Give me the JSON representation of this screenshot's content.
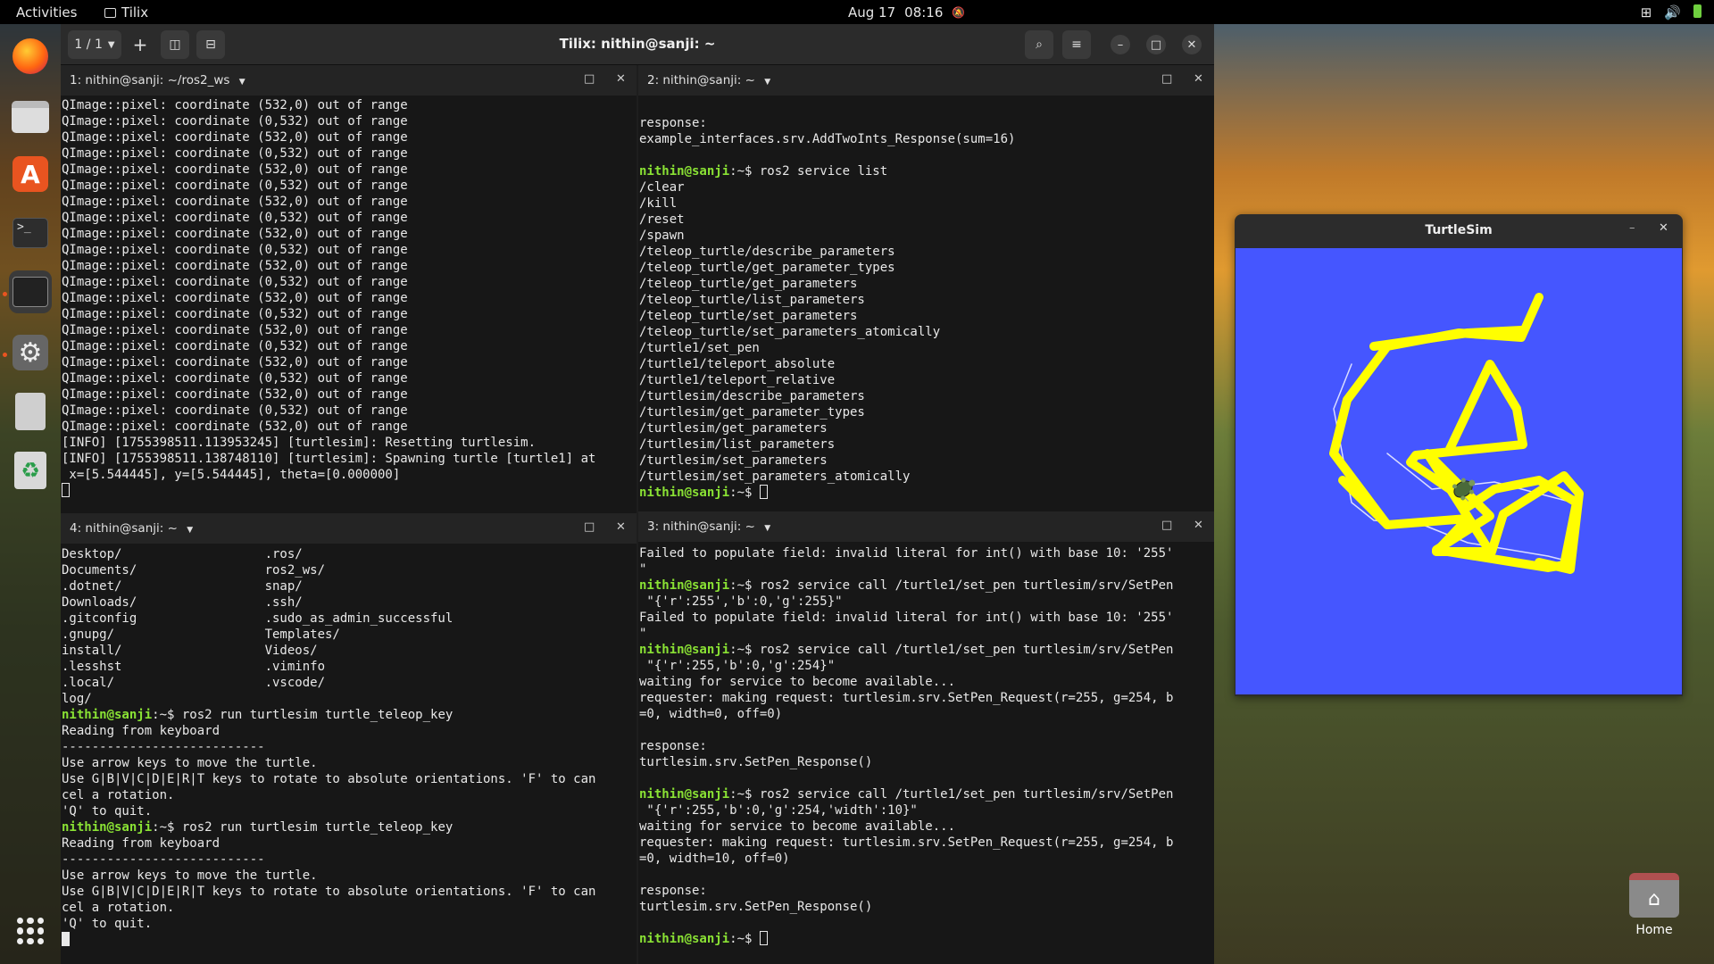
{
  "topbar": {
    "activities": "Activities",
    "app_name": "Tilix",
    "date": "Aug 17",
    "time": "08:16"
  },
  "tilix": {
    "session": "1 / 1",
    "title": "Tilix: nithin@sanji: ~"
  },
  "panes": {
    "p1": {
      "title": "1: nithin@sanji: ~/ros2_ws",
      "lines": [
        "QImage::pixel: coordinate (532,0) out of range",
        "QImage::pixel: coordinate (0,532) out of range",
        "QImage::pixel: coordinate (532,0) out of range",
        "QImage::pixel: coordinate (0,532) out of range",
        "QImage::pixel: coordinate (532,0) out of range",
        "QImage::pixel: coordinate (0,532) out of range",
        "QImage::pixel: coordinate (532,0) out of range",
        "QImage::pixel: coordinate (0,532) out of range",
        "QImage::pixel: coordinate (532,0) out of range",
        "QImage::pixel: coordinate (0,532) out of range",
        "QImage::pixel: coordinate (532,0) out of range",
        "QImage::pixel: coordinate (0,532) out of range",
        "QImage::pixel: coordinate (532,0) out of range",
        "QImage::pixel: coordinate (0,532) out of range",
        "QImage::pixel: coordinate (532,0) out of range",
        "QImage::pixel: coordinate (0,532) out of range",
        "QImage::pixel: coordinate (532,0) out of range",
        "QImage::pixel: coordinate (0,532) out of range",
        "QImage::pixel: coordinate (532,0) out of range",
        "QImage::pixel: coordinate (0,532) out of range",
        "QImage::pixel: coordinate (532,0) out of range",
        "[INFO] [1755398511.113953245] [turtlesim]: Resetting turtlesim.",
        "[INFO] [1755398511.138748110] [turtlesim]: Spawning turtle [turtle1] at",
        " x=[5.544445], y=[5.544445], theta=[0.000000]"
      ]
    },
    "p2": {
      "title": "2: nithin@sanji: ~",
      "lines": [
        {
          "t": "response:"
        },
        {
          "t": "example_interfaces.srv.AddTwoInts_Response(sum=16)"
        },
        {
          "t": ""
        },
        {
          "p": "nithin@sanji",
          "t": ":~$ ros2 service list"
        },
        {
          "t": "/clear"
        },
        {
          "t": "/kill"
        },
        {
          "t": "/reset"
        },
        {
          "t": "/spawn"
        },
        {
          "t": "/teleop_turtle/describe_parameters"
        },
        {
          "t": "/teleop_turtle/get_parameter_types"
        },
        {
          "t": "/teleop_turtle/get_parameters"
        },
        {
          "t": "/teleop_turtle/list_parameters"
        },
        {
          "t": "/teleop_turtle/set_parameters"
        },
        {
          "t": "/teleop_turtle/set_parameters_atomically"
        },
        {
          "t": "/turtle1/set_pen"
        },
        {
          "t": "/turtle1/teleport_absolute"
        },
        {
          "t": "/turtle1/teleport_relative"
        },
        {
          "t": "/turtlesim/describe_parameters"
        },
        {
          "t": "/turtlesim/get_parameter_types"
        },
        {
          "t": "/turtlesim/get_parameters"
        },
        {
          "t": "/turtlesim/list_parameters"
        },
        {
          "t": "/turtlesim/set_parameters"
        },
        {
          "t": "/turtlesim/set_parameters_atomically"
        },
        {
          "p": "nithin@sanji",
          "t": ":~$ ",
          "cursor": true
        }
      ]
    },
    "p4": {
      "title": "4: nithin@sanji: ~",
      "lines": [
        {
          "t": "Desktop/                   .ros/"
        },
        {
          "t": "Documents/                 ros2_ws/"
        },
        {
          "t": ".dotnet/                   snap/"
        },
        {
          "t": "Downloads/                 .ssh/"
        },
        {
          "t": ".gitconfig                 .sudo_as_admin_successful"
        },
        {
          "t": ".gnupg/                    Templates/"
        },
        {
          "t": "install/                   Videos/"
        },
        {
          "t": ".lesshst                   .viminfo"
        },
        {
          "t": ".local/                    .vscode/"
        },
        {
          "t": "log/"
        },
        {
          "p": "nithin@sanji",
          "t": ":~$ ros2 run turtlesim turtle_teleop_key"
        },
        {
          "t": "Reading from keyboard"
        },
        {
          "t": "---------------------------"
        },
        {
          "t": "Use arrow keys to move the turtle."
        },
        {
          "t": "Use G|B|V|C|D|E|R|T keys to rotate to absolute orientations. 'F' to can"
        },
        {
          "t": "cel a rotation."
        },
        {
          "t": "'Q' to quit."
        },
        {
          "p": "nithin@sanji",
          "t": ":~$ ros2 run turtlesim turtle_teleop_key"
        },
        {
          "t": "Reading from keyboard"
        },
        {
          "t": "---------------------------"
        },
        {
          "t": "Use arrow keys to move the turtle."
        },
        {
          "t": "Use G|B|V|C|D|E|R|T keys to rotate to absolute orientations. 'F' to can"
        },
        {
          "t": "cel a rotation."
        },
        {
          "t": "'Q' to quit."
        }
      ]
    },
    "p3": {
      "title": "3: nithin@sanji: ~",
      "lines": [
        {
          "t": "Failed to populate field: invalid literal for int() with base 10: '255'"
        },
        {
          "t": "\""
        },
        {
          "p": "nithin@sanji",
          "t": ":~$ ros2 service call /turtle1/set_pen turtlesim/srv/SetPen"
        },
        {
          "t": " \"{'r':255','b':0,'g':255}\""
        },
        {
          "t": "Failed to populate field: invalid literal for int() with base 10: '255'"
        },
        {
          "t": "\""
        },
        {
          "p": "nithin@sanji",
          "t": ":~$ ros2 service call /turtle1/set_pen turtlesim/srv/SetPen"
        },
        {
          "t": " \"{'r':255,'b':0,'g':254}\""
        },
        {
          "t": "waiting for service to become available..."
        },
        {
          "t": "requester: making request: turtlesim.srv.SetPen_Request(r=255, g=254, b"
        },
        {
          "t": "=0, width=0, off=0)"
        },
        {
          "t": ""
        },
        {
          "t": "response:"
        },
        {
          "t": "turtlesim.srv.SetPen_Response()"
        },
        {
          "t": ""
        },
        {
          "p": "nithin@sanji",
          "t": ":~$ ros2 service call /turtle1/set_pen turtlesim/srv/SetPen"
        },
        {
          "t": " \"{'r':255,'b':0,'g':254,'width':10}\""
        },
        {
          "t": "waiting for service to become available..."
        },
        {
          "t": "requester: making request: turtlesim.srv.SetPen_Request(r=255, g=254, b"
        },
        {
          "t": "=0, width=10, off=0)"
        },
        {
          "t": ""
        },
        {
          "t": "response:"
        },
        {
          "t": "turtlesim.srv.SetPen_Response()"
        },
        {
          "t": ""
        },
        {
          "p": "nithin@sanji",
          "t": ":~$ ",
          "cursor": true
        }
      ]
    }
  },
  "turtlesim": {
    "title": "TurtleSim",
    "background": "#4556ff",
    "pen_color": "#fffe00"
  },
  "desktop": {
    "home_label": "Home"
  },
  "colors": {
    "prompt": "#8ae234",
    "accent": "#e95420"
  }
}
